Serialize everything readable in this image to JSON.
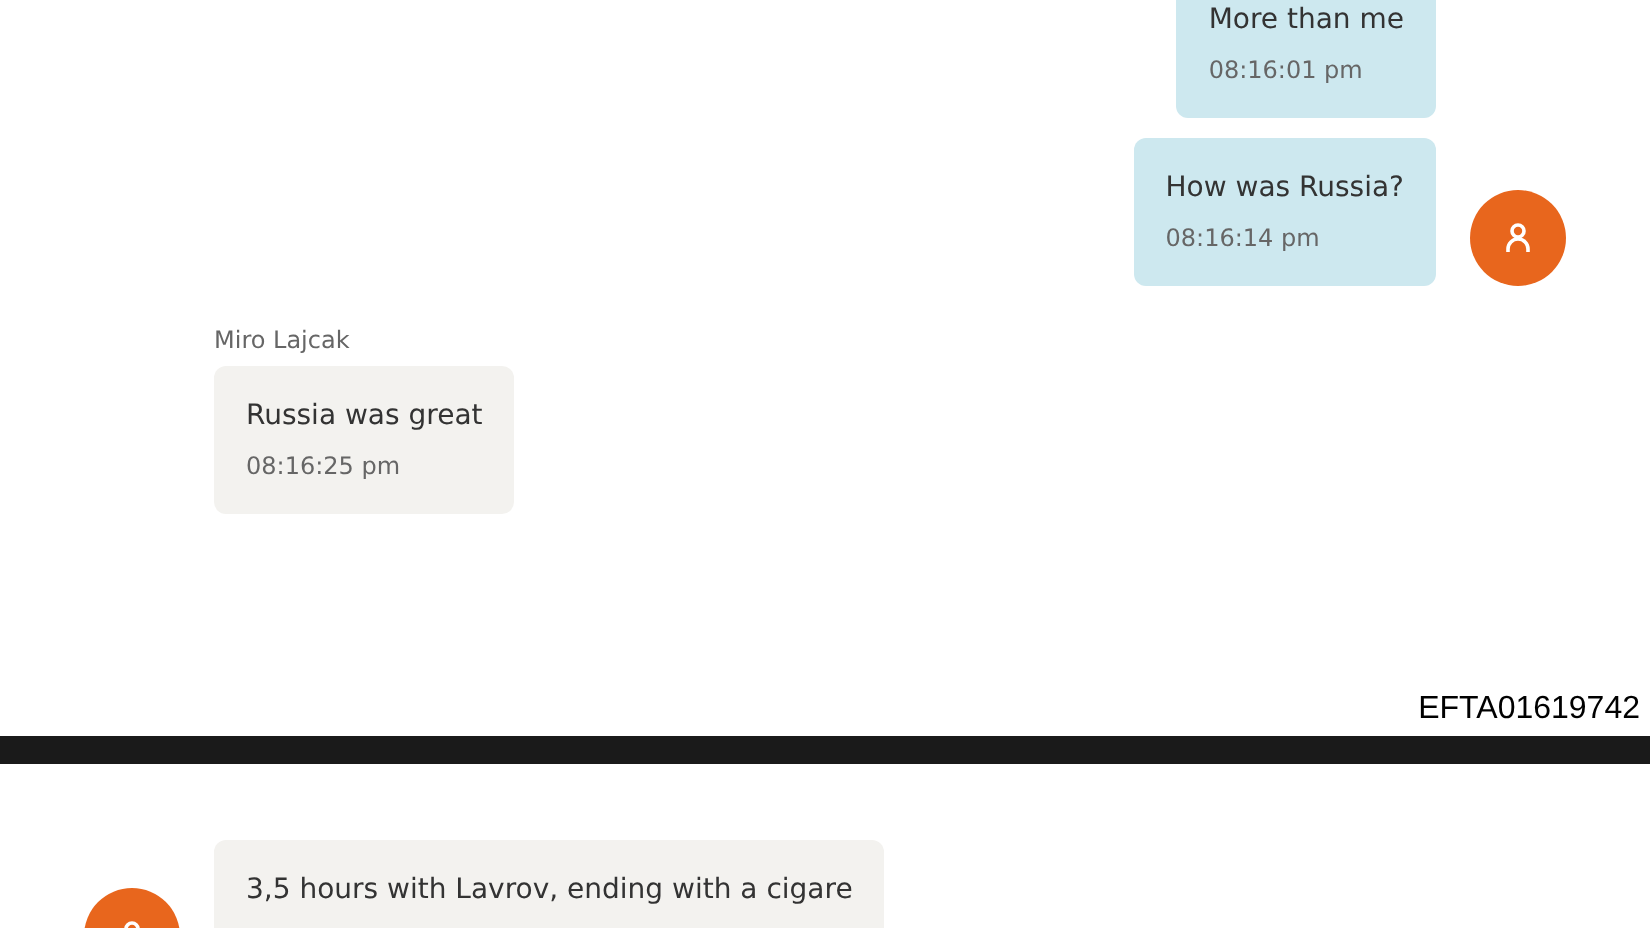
{
  "pages": [
    {
      "messages": [
        {
          "kind": "outgoing",
          "text": "More than me",
          "time": "08:16:01 pm",
          "avatar": false
        },
        {
          "kind": "outgoing",
          "text": "How was Russia?",
          "time": "08:16:14 pm",
          "avatar": true
        },
        {
          "kind": "incoming",
          "sender": "Miro Lajcak",
          "text": "Russia was great",
          "time": "08:16:25 pm",
          "avatar": false
        }
      ],
      "stamp": "EFTA01619742"
    },
    {
      "messages": [
        {
          "kind": "incoming",
          "text": "3,5 hours with Lavrov, ending with a cigare",
          "avatar": true
        }
      ]
    }
  ]
}
